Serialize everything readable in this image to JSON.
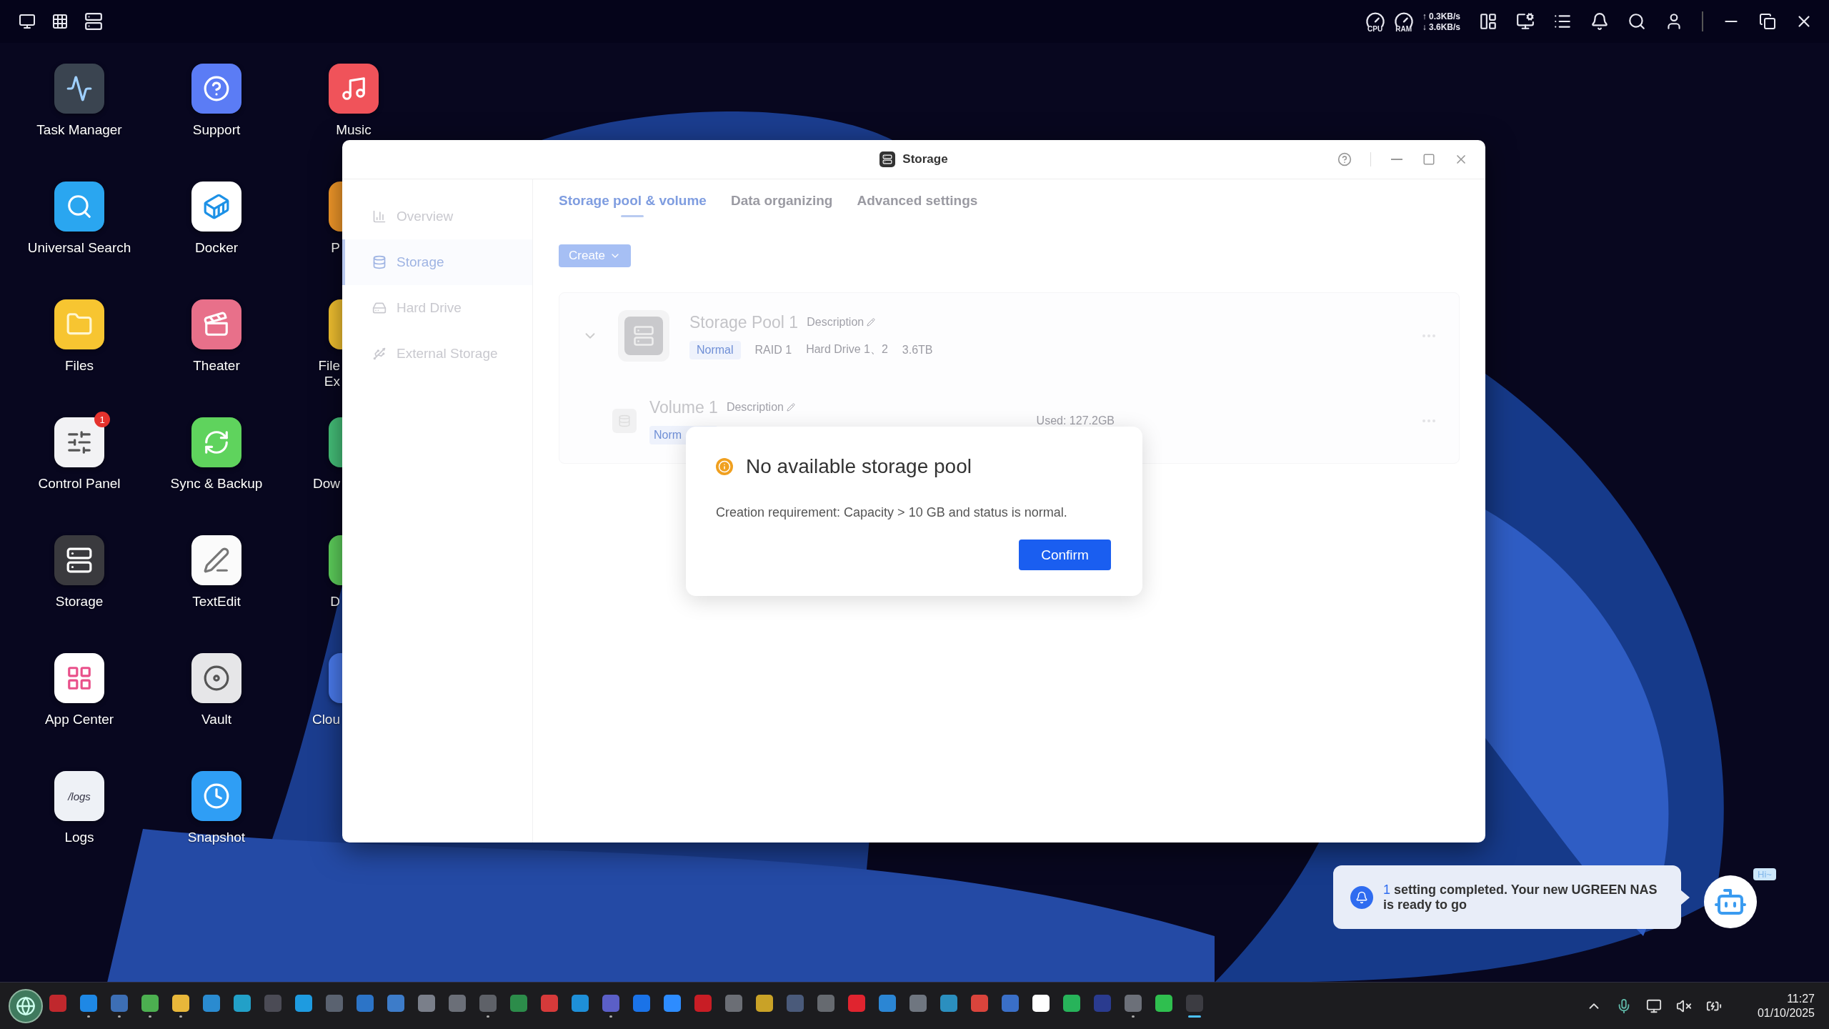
{
  "topbar": {
    "cpu_label": "CPU",
    "ram_label": "RAM",
    "net_up": "↑ 0.3KB/s",
    "net_down": "↓ 3.6KB/s"
  },
  "desktop": {
    "columns": [
      [
        {
          "label": "Task Manager",
          "kind": "task-manager"
        },
        {
          "label": "Universal Search",
          "kind": "search"
        },
        {
          "label": "Files",
          "kind": "files"
        },
        {
          "label": "Control Panel",
          "kind": "control-panel",
          "badge": "1"
        },
        {
          "label": "Storage",
          "kind": "storage"
        },
        {
          "label": "App Center",
          "kind": "app-center"
        },
        {
          "label": "Logs",
          "kind": "logs",
          "icon_text": "/logs"
        }
      ],
      [
        {
          "label": "Support",
          "kind": "support"
        },
        {
          "label": "Docker",
          "kind": "docker"
        },
        {
          "label": "Theater",
          "kind": "theater"
        },
        {
          "label": "Sync & Backup",
          "kind": "sync"
        },
        {
          "label": "TextEdit",
          "kind": "textedit"
        },
        {
          "label": "Vault",
          "kind": "vault"
        },
        {
          "label": "Snapshot",
          "kind": "snapshot"
        }
      ],
      [
        {
          "label": "Music",
          "kind": "music"
        },
        {
          "label": "P",
          "kind": "photos"
        },
        {
          "label": "File Ex",
          "kind": "files"
        },
        {
          "label": "Dow",
          "kind": "download"
        },
        {
          "label": "D",
          "kind": "sync"
        },
        {
          "label": "Clou",
          "kind": "cloud"
        }
      ]
    ]
  },
  "window": {
    "title": "Storage",
    "sidebar": [
      {
        "label": "Overview",
        "kind": "overview",
        "selected": false
      },
      {
        "label": "Storage",
        "kind": "storage",
        "selected": true
      },
      {
        "label": "Hard Drive",
        "kind": "drive",
        "selected": false
      },
      {
        "label": "External Storage",
        "kind": "external",
        "selected": false
      }
    ],
    "tabs": [
      {
        "label": "Storage pool & volume",
        "selected": true
      },
      {
        "label": "Data organizing",
        "selected": false
      },
      {
        "label": "Advanced settings",
        "selected": false
      }
    ],
    "create_button": "Create",
    "pool": {
      "name": "Storage Pool 1",
      "description": "Description",
      "expanded": true,
      "status": "Normal",
      "raid": "RAID 1",
      "drives": "Hard Drive 1、2",
      "capacity": "3.6TB"
    },
    "volume": {
      "name": "Volume 1",
      "description": "Description",
      "status": "Norm",
      "used": "Used: 127.2GB"
    }
  },
  "dialog": {
    "title": "No available storage pool",
    "message": "Creation requirement: Capacity > 10 GB and status is normal.",
    "button": "Confirm"
  },
  "notification": {
    "count": "1",
    "text": "setting completed. Your new UGREEN NAS is ready to go"
  },
  "assistant": {
    "greeting": "Hi~"
  },
  "taskbar": {
    "apps": [
      {
        "running": false,
        "selected": false
      },
      {
        "running": true,
        "selected": false
      },
      {
        "running": true,
        "selected": false
      },
      {
        "running": true,
        "selected": false
      },
      {
        "running": true,
        "selected": false
      },
      {
        "running": false,
        "selected": false
      },
      {
        "running": false,
        "selected": false
      },
      {
        "running": false,
        "selected": false
      },
      {
        "running": false,
        "selected": false
      },
      {
        "running": false,
        "selected": false
      },
      {
        "running": false,
        "selected": false
      },
      {
        "running": false,
        "selected": false
      },
      {
        "running": false,
        "selected": false
      },
      {
        "running": false,
        "selected": false
      },
      {
        "running": true,
        "selected": false
      },
      {
        "running": false,
        "selected": false
      },
      {
        "running": false,
        "selected": false
      },
      {
        "running": false,
        "selected": false
      },
      {
        "running": true,
        "selected": false
      },
      {
        "running": false,
        "selected": false
      },
      {
        "running": false,
        "selected": false
      },
      {
        "running": false,
        "selected": false
      },
      {
        "running": false,
        "selected": false
      },
      {
        "running": false,
        "selected": false
      },
      {
        "running": false,
        "selected": false
      },
      {
        "running": false,
        "selected": false
      },
      {
        "running": false,
        "selected": false
      },
      {
        "running": false,
        "selected": false
      },
      {
        "running": false,
        "selected": false
      },
      {
        "running": false,
        "selected": false
      },
      {
        "running": false,
        "selected": false
      },
      {
        "running": false,
        "selected": false
      },
      {
        "running": false,
        "selected": false
      },
      {
        "running": false,
        "selected": false
      },
      {
        "running": false,
        "selected": false
      },
      {
        "running": true,
        "selected": false
      },
      {
        "running": false,
        "selected": false
      },
      {
        "running": true,
        "selected": true
      }
    ],
    "time": "11:27",
    "date": "01/10/2025"
  }
}
